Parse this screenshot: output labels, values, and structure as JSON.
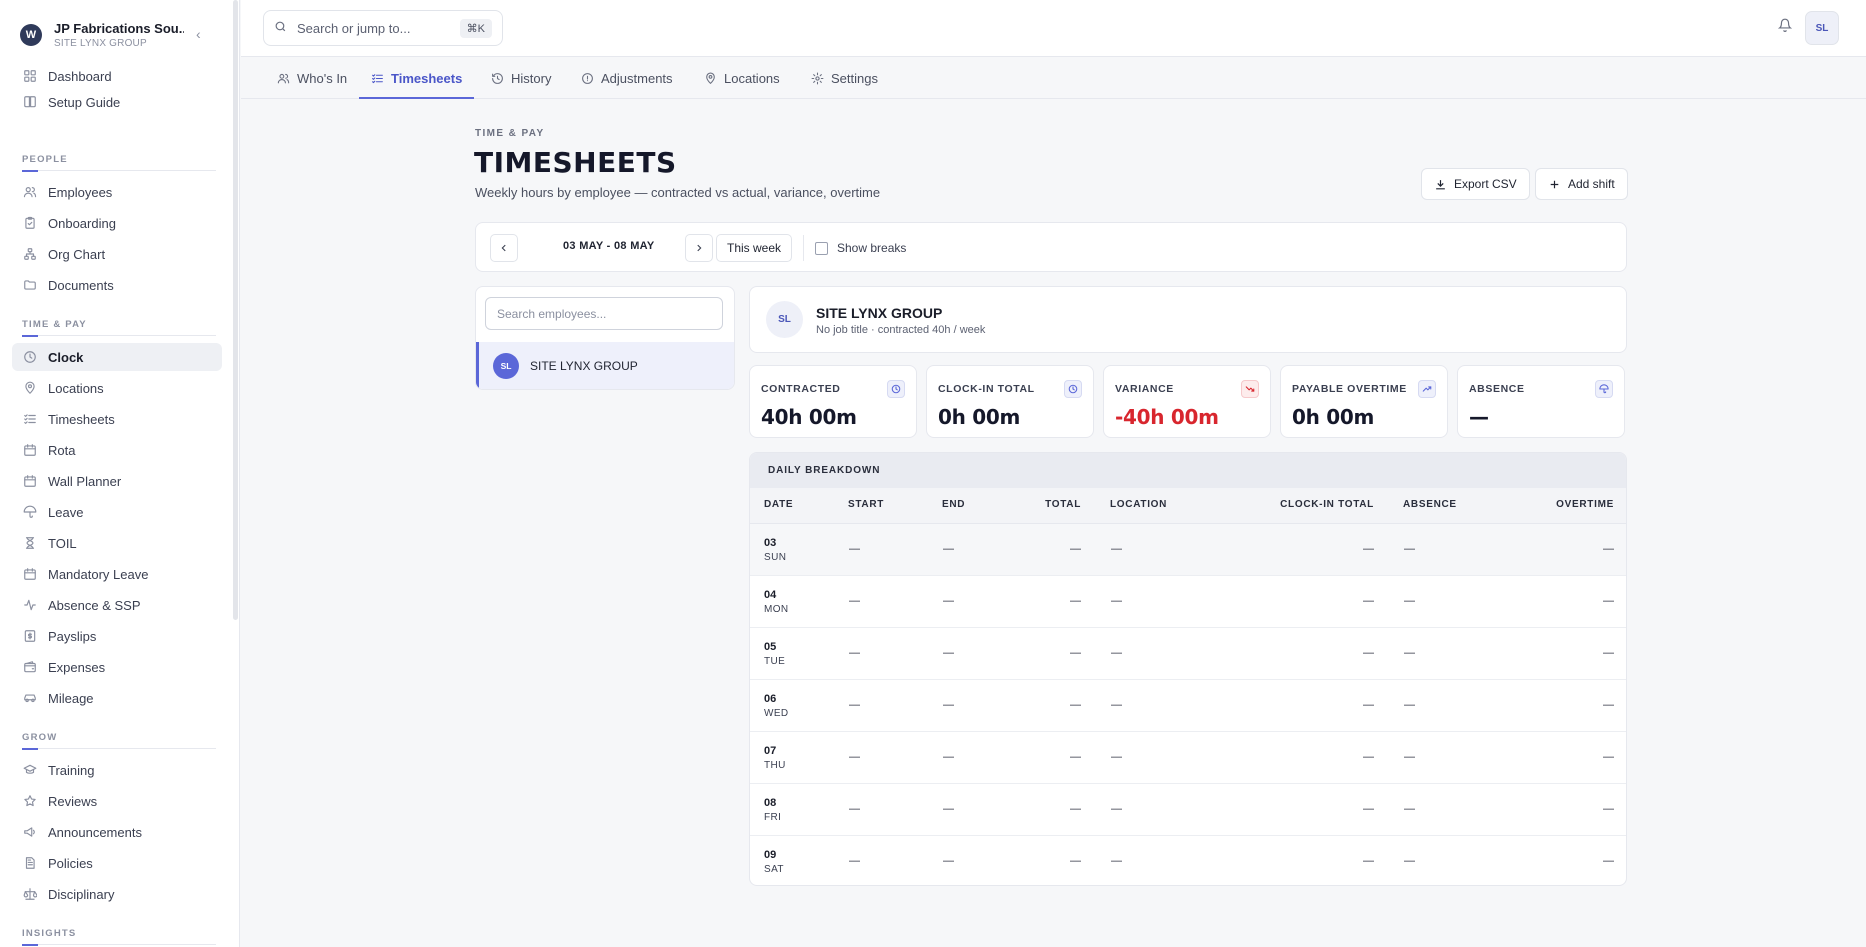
{
  "org": {
    "name": "JP Fabrications Sou...",
    "sub": "SITE LYNX GROUP",
    "logo": "W"
  },
  "sidebar": {
    "top": [
      {
        "label": "Dashboard",
        "icon": "dashboard-icon"
      },
      {
        "label": "Setup Guide",
        "icon": "book-icon"
      }
    ],
    "sections": [
      {
        "title": "PEOPLE",
        "items": [
          {
            "label": "Employees",
            "icon": "users-icon"
          },
          {
            "label": "Onboarding",
            "icon": "clipboard-icon"
          },
          {
            "label": "Org Chart",
            "icon": "org-chart-icon"
          },
          {
            "label": "Documents",
            "icon": "folder-icon"
          }
        ]
      },
      {
        "title": "TIME & PAY",
        "items": [
          {
            "label": "Clock",
            "icon": "clock-icon",
            "active": true
          },
          {
            "label": "Locations",
            "icon": "map-pin-icon"
          },
          {
            "label": "Timesheets",
            "icon": "list-check-icon"
          },
          {
            "label": "Rota",
            "icon": "calendar-icon"
          },
          {
            "label": "Wall Planner",
            "icon": "calendar-icon"
          },
          {
            "label": "Leave",
            "icon": "umbrella-icon"
          },
          {
            "label": "TOIL",
            "icon": "hourglass-icon"
          },
          {
            "label": "Mandatory Leave",
            "icon": "calendar-icon"
          },
          {
            "label": "Absence & SSP",
            "icon": "activity-icon"
          },
          {
            "label": "Payslips",
            "icon": "receipt-icon"
          },
          {
            "label": "Expenses",
            "icon": "wallet-icon"
          },
          {
            "label": "Mileage",
            "icon": "car-icon"
          }
        ]
      },
      {
        "title": "GROW",
        "items": [
          {
            "label": "Training",
            "icon": "graduation-cap-icon"
          },
          {
            "label": "Reviews",
            "icon": "star-icon"
          },
          {
            "label": "Announcements",
            "icon": "megaphone-icon"
          },
          {
            "label": "Policies",
            "icon": "file-text-icon"
          },
          {
            "label": "Disciplinary",
            "icon": "scale-icon"
          }
        ]
      },
      {
        "title": "INSIGHTS",
        "items": []
      }
    ]
  },
  "topbar": {
    "search_placeholder": "Search or jump to...",
    "shortcut": "⌘K",
    "avatar": "SL"
  },
  "tabs": [
    {
      "label": "Who's In",
      "icon": "users-icon"
    },
    {
      "label": "Timesheets",
      "icon": "list-check-icon",
      "active": true
    },
    {
      "label": "History",
      "icon": "history-icon"
    },
    {
      "label": "Adjustments",
      "icon": "alert-circle-icon"
    },
    {
      "label": "Locations",
      "icon": "map-pin-icon"
    },
    {
      "label": "Settings",
      "icon": "gear-icon"
    }
  ],
  "header": {
    "eyebrow": "TIME & PAY",
    "title": "TIMESHEETS",
    "subtitle": "Weekly hours by employee — contracted vs actual, variance, overtime",
    "export_label": "Export CSV",
    "add_label": "Add shift"
  },
  "week": {
    "range": "03 MAY - 08 MAY",
    "this_week": "This week",
    "show_breaks": "Show breaks",
    "show_breaks_checked": false
  },
  "employees": {
    "search_placeholder": "Search employees...",
    "list": [
      {
        "initials": "SL",
        "name": "SITE LYNX GROUP",
        "selected": true
      }
    ]
  },
  "selected": {
    "initials": "SL",
    "name": "SITE LYNX GROUP",
    "meta": "No job title · contracted 40h / week"
  },
  "stats": [
    {
      "label": "CONTRACTED",
      "value": "40h 00m",
      "icon": "clock-icon"
    },
    {
      "label": "CLOCK-IN TOTAL",
      "value": "0h 00m",
      "icon": "clock-icon"
    },
    {
      "label": "VARIANCE",
      "value": "-40h 00m",
      "icon": "trending-down-icon",
      "negative": true
    },
    {
      "label": "PAYABLE OVERTIME",
      "value": "0h 00m",
      "icon": "trending-up-icon"
    },
    {
      "label": "ABSENCE",
      "value": "—",
      "icon": "umbrella-icon"
    }
  ],
  "breakdown": {
    "title": "DAILY BREAKDOWN",
    "columns": [
      "DATE",
      "START",
      "END",
      "TOTAL",
      "LOCATION",
      "CLOCK-IN TOTAL",
      "ABSENCE",
      "OVERTIME"
    ],
    "rows": [
      {
        "day": "03",
        "dow": "SUN",
        "start": "—",
        "end": "—",
        "total": "—",
        "location": "—",
        "clockin": "—",
        "absence": "—",
        "overtime": "—"
      },
      {
        "day": "04",
        "dow": "MON",
        "start": "—",
        "end": "—",
        "total": "—",
        "location": "—",
        "clockin": "—",
        "absence": "—",
        "overtime": "—"
      },
      {
        "day": "05",
        "dow": "TUE",
        "start": "—",
        "end": "—",
        "total": "—",
        "location": "—",
        "clockin": "—",
        "absence": "—",
        "overtime": "—"
      },
      {
        "day": "06",
        "dow": "WED",
        "start": "—",
        "end": "—",
        "total": "—",
        "location": "—",
        "clockin": "—",
        "absence": "—",
        "overtime": "—"
      },
      {
        "day": "07",
        "dow": "THU",
        "start": "—",
        "end": "—",
        "total": "—",
        "location": "—",
        "clockin": "—",
        "absence": "—",
        "overtime": "—"
      },
      {
        "day": "08",
        "dow": "FRI",
        "start": "—",
        "end": "—",
        "total": "—",
        "location": "—",
        "clockin": "—",
        "absence": "—",
        "overtime": "—"
      },
      {
        "day": "09",
        "dow": "SAT",
        "start": "—",
        "end": "—",
        "total": "—",
        "location": "—",
        "clockin": "—",
        "absence": "—",
        "overtime": "—"
      }
    ]
  },
  "colors": {
    "accent": "#5b67d8",
    "negative": "#d8262e"
  }
}
